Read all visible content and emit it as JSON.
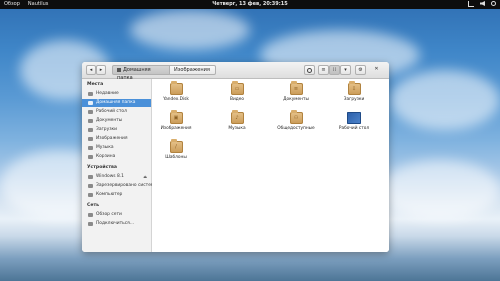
{
  "top_panel": {
    "activities": "Обзор",
    "app_name": "Nautilus",
    "clock": "Четверг, 13 фев, 20:39:15"
  },
  "window": {
    "breadcrumbs": [
      "Домашняя папка",
      "Изображения"
    ],
    "sidebar": {
      "sections": [
        {
          "title": "Места",
          "items": [
            "Недавние",
            "Домашняя папка",
            "Рабочий стол",
            "Документы",
            "Загрузки",
            "Изображения",
            "Музыка",
            "Корзина"
          ]
        },
        {
          "title": "Устройства",
          "items": [
            "Windows 8.1",
            "Зарезервировано системой",
            "Компьютер"
          ]
        },
        {
          "title": "Сеть",
          "items": [
            "Обзор сети",
            "Подключиться..."
          ]
        }
      ]
    },
    "files": [
      {
        "name": "Yandex.Disk",
        "icon": "folder-icon",
        "symbol": ""
      },
      {
        "name": "Видео",
        "icon": "video-folder-icon",
        "symbol": "▭"
      },
      {
        "name": "Документы",
        "icon": "documents-folder-icon",
        "symbol": "≡"
      },
      {
        "name": "Загрузки",
        "icon": "downloads-folder-icon",
        "symbol": "⇩"
      },
      {
        "name": "Изображения",
        "icon": "pictures-folder-icon",
        "symbol": "▣"
      },
      {
        "name": "Музыка",
        "icon": "music-folder-icon",
        "symbol": "♪"
      },
      {
        "name": "Общедоступные",
        "icon": "public-folder-icon",
        "symbol": "⚇"
      },
      {
        "name": "Рабочий стол",
        "icon": "desktop-folder-icon",
        "symbol": ""
      },
      {
        "name": "Шаблоны",
        "icon": "templates-folder-icon",
        "symbol": "/"
      }
    ]
  }
}
